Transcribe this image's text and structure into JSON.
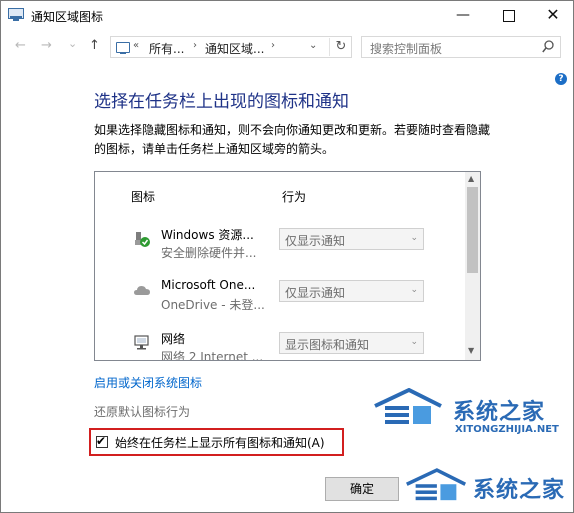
{
  "window": {
    "title": "通知区域图标",
    "minimize": "—",
    "close": "✕"
  },
  "nav": {
    "back": "←",
    "forward": "→",
    "recent": "⌄",
    "up": "↑",
    "breadcrumb_overflow": "«",
    "crumb1": "所有...",
    "crumb2": "通知区域...",
    "sep": "›",
    "dropdown": "⌄",
    "refresh": "↻",
    "search_placeholder": "搜索控制面板",
    "help": "?"
  },
  "content": {
    "heading": "选择在任务栏上出现的图标和通知",
    "description": "如果选择隐藏图标和通知，则不会向你通知更改和更新。若要随时查看隐藏的图标，请单击任务栏上通知区域旁的箭头。",
    "col_icon": "图标",
    "col_behavior": "行为",
    "rows": [
      {
        "name": "Windows 资源...",
        "sub": "安全删除硬件并...",
        "behavior": "仅显示通知",
        "icon": "usb-safely-remove-icon"
      },
      {
        "name": "Microsoft One...",
        "sub": "OneDrive - 未登...",
        "behavior": "仅显示通知",
        "icon": "onedrive-cloud-icon"
      },
      {
        "name": "网络",
        "sub": "网络  2 Internet ...",
        "behavior": "显示图标和通知",
        "icon": "network-icon"
      }
    ],
    "select_arrow": "⌄",
    "scroll_up": "▲",
    "scroll_down": "▼",
    "system_icons_link": "启用或关闭系统图标",
    "restore_defaults": "还原默认图标行为",
    "always_show_label": "始终在任务栏上显示所有图标和通知(A)",
    "always_show_checked": true,
    "check_mark": "✔",
    "ok_button": "确定"
  },
  "watermark": {
    "brand": "系统之家",
    "url": "XITONGZHIJIA.NET"
  },
  "colors": {
    "heading": "#1e3287",
    "link": "#0066cc",
    "highlight_border": "#d21f1f",
    "watermark": "#2a6ab5"
  }
}
